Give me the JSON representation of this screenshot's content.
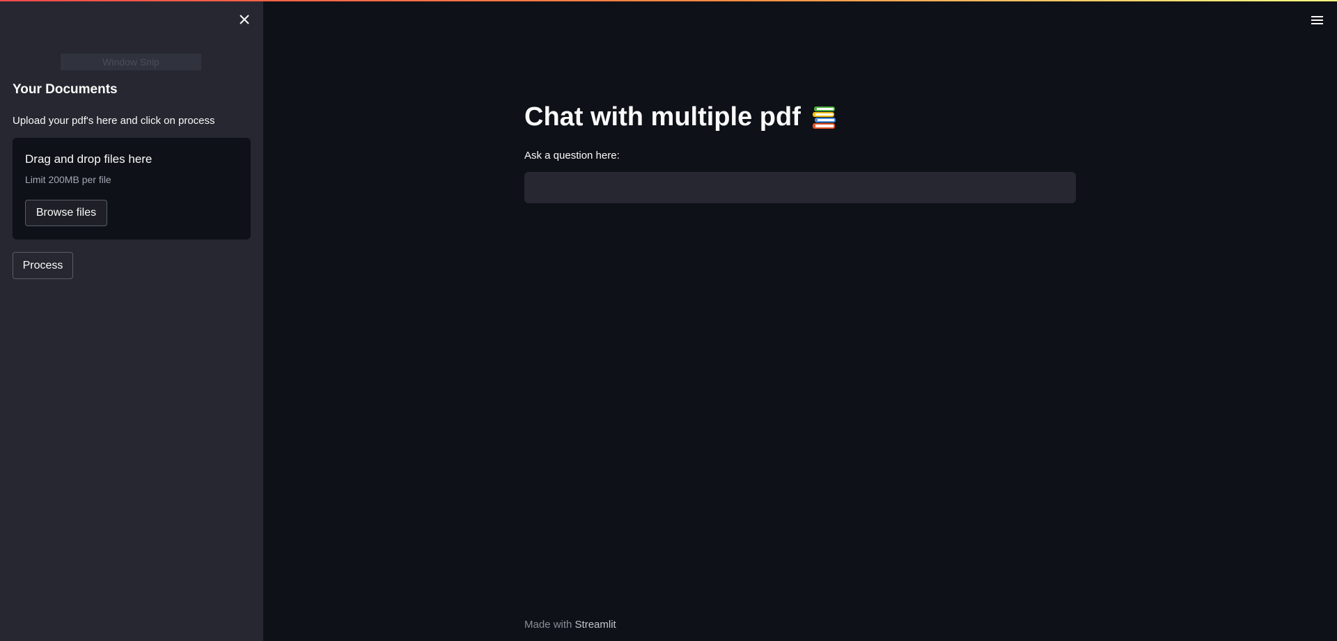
{
  "sidebar": {
    "snip_overlay_text": "Window Snip",
    "heading": "Your Documents",
    "instructions": "Upload your pdf's here and click on process",
    "uploader": {
      "title": "Drag and drop files here",
      "limit": "Limit 200MB per file",
      "browse_label": "Browse files"
    },
    "process_label": "Process",
    "close_icon": "close-icon"
  },
  "main": {
    "title": "Chat with multiple pdf",
    "title_icon": "books-icon",
    "question_label": "Ask a question here:",
    "question_value": "",
    "menu_icon": "hamburger-menu-icon"
  },
  "footer": {
    "prefix": "Made with",
    "link_text": "Streamlit"
  },
  "colors": {
    "background": "#0e1117",
    "sidebar": "#262730",
    "text": "#fafafa",
    "accent_gradient_start": "#ff4b4b",
    "accent_gradient_end": "#fffd80"
  }
}
